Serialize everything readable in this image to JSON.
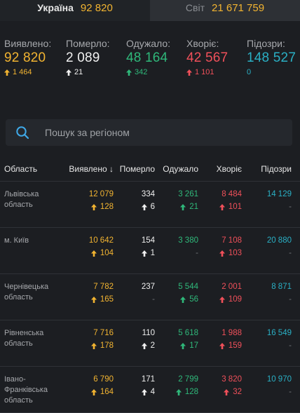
{
  "tabs": [
    {
      "name": "Україна",
      "count": "92 820"
    },
    {
      "name": "Світ",
      "count": "21 671 759"
    }
  ],
  "summary": [
    {
      "label": "Виявлено:",
      "value": "92 820",
      "delta": "1 464",
      "color": "yellow"
    },
    {
      "label": "Померло:",
      "value": "2 089",
      "delta": "21",
      "color": "white"
    },
    {
      "label": "Одужало:",
      "value": "48 164",
      "delta": "342",
      "color": "green"
    },
    {
      "label": "Хворіє:",
      "value": "42 567",
      "delta": "1 101",
      "color": "red"
    },
    {
      "label": "Підозри:",
      "value": "148 527",
      "delta": "0",
      "color": "blue"
    }
  ],
  "search": {
    "placeholder": "Пошук за регіоном"
  },
  "table": {
    "headers": [
      "Область",
      "Виявлено",
      "Померло",
      "Одужало",
      "Хворіє",
      "Підозри"
    ],
    "sort_arrow": "↓",
    "rows": [
      {
        "name": "Львівська область",
        "confirmed": "12 079",
        "confirmed_d": "128",
        "deaths": "334",
        "deaths_d": "6",
        "recovered": "3 261",
        "recovered_d": "21",
        "sick": "8 484",
        "sick_d": "101",
        "suspected": "14 129",
        "suspected_d": "-"
      },
      {
        "name": "м. Київ",
        "confirmed": "10 642",
        "confirmed_d": "104",
        "deaths": "154",
        "deaths_d": "1",
        "recovered": "3 380",
        "recovered_d": "-",
        "sick": "7 108",
        "sick_d": "103",
        "suspected": "20 880",
        "suspected_d": "-"
      },
      {
        "name": "Чернівецька область",
        "confirmed": "7 782",
        "confirmed_d": "165",
        "deaths": "237",
        "deaths_d": "-",
        "recovered": "5 544",
        "recovered_d": "56",
        "sick": "2 001",
        "sick_d": "109",
        "suspected": "8 871",
        "suspected_d": "-"
      },
      {
        "name": "Рівненська область",
        "confirmed": "7 716",
        "confirmed_d": "178",
        "deaths": "110",
        "deaths_d": "2",
        "recovered": "5 618",
        "recovered_d": "17",
        "sick": "1 988",
        "sick_d": "159",
        "suspected": "16 549",
        "suspected_d": "-"
      },
      {
        "name": "Івано-Франківська область",
        "confirmed": "6 790",
        "confirmed_d": "164",
        "deaths": "171",
        "deaths_d": "4",
        "recovered": "2 799",
        "recovered_d": "128",
        "sick": "3 820",
        "sick_d": "32",
        "suspected": "10 970",
        "suspected_d": "-"
      }
    ]
  },
  "colors": {
    "yellow": "#f2b431",
    "white": "#f0f0f0",
    "green": "#2fb87a",
    "red": "#f0505a",
    "blue": "#2ab0c5"
  },
  "icons": {
    "search": "search-icon",
    "up_arrow": "arrow-up-icon"
  }
}
